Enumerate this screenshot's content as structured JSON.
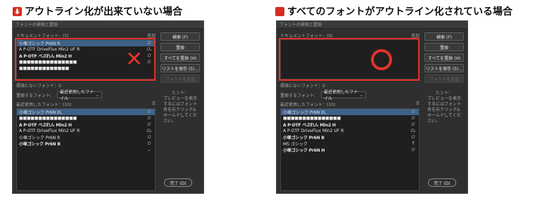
{
  "captions": {
    "left": "アウトライン化が出来ていない場合",
    "right": "すべてのフォントがアウトライン化されている場合"
  },
  "colors": {
    "accent_red": "#e4312b",
    "selection": "#3f6188"
  },
  "left_dialog": {
    "title": "フォントの検索と置換",
    "doc_header": "ドキュメントフォント：(5)",
    "doc_header_right": "追加",
    "doc_fonts": [
      {
        "name": "小塚ゴシック Pr6N R",
        "icon": "𝑂",
        "selected": true,
        "bold": false
      },
      {
        "name": "A P-OTF DriveFlux Min2 UF R",
        "icon": "𝑂ₐ",
        "selected": false,
        "bold": false
      },
      {
        "name": "A P-OTF ぺぷれん Min2 H",
        "icon": "𝑂",
        "selected": false,
        "bold": true
      },
      {
        "name": "■■■■■■■■■■■■■■■",
        "icon": "𝑂",
        "selected": false,
        "bold": true
      },
      {
        "name": "■■■■■■■■■■■■■",
        "icon": "",
        "selected": false,
        "bold": true
      }
    ],
    "no_fonts": "環境にないフォント：0",
    "replace_label": "置換するフォント：",
    "replace_value": "最近使用したファイル",
    "recent_header": "最近使用したフォント：(10)",
    "recent_fonts": [
      {
        "name": "小塚ゴシック Pr6N EL",
        "icon": "𝑂",
        "selected": true,
        "bold": false
      },
      {
        "name": "■■■■■■■■■■■■■■■",
        "icon": "𝑂",
        "selected": false,
        "bold": true
      },
      {
        "name": "A P-OTF ぺぷれん Min2 H",
        "icon": "𝑂",
        "selected": false,
        "bold": true
      },
      {
        "name": "A P-OTF DriveFlux Min2 UF R",
        "icon": "𝑂ₐ",
        "selected": false,
        "bold": false
      },
      {
        "name": "小塚ゴシック Pr6N R",
        "icon": "𝑂",
        "selected": false,
        "bold": false
      },
      {
        "name": "小塚ゴシック Pr6N B",
        "icon": "𝑂",
        "selected": false,
        "bold": true
      },
      {
        "name": "",
        "icon": "⌄",
        "selected": false,
        "bold": false
      }
    ],
    "buttons": {
      "find": "検索 (F)",
      "replace": "置換",
      "replace_all": "すべてを置換 (H)",
      "save_list": "リストを保存 (S)...",
      "add_font": "フォントを追加"
    },
    "hint_title": "ヒント：",
    "hint_text": "プレビューを表示するにはフォント名を右クリック&ホールドしてください。",
    "done": "完了 (D)",
    "mark": "✕"
  },
  "right_dialog": {
    "title": "フォントの検索と置換",
    "doc_header": "ドキュメントフォント：(0)",
    "doc_header_right": "追加",
    "no_fonts": "環境にないフォント：0",
    "replace_label": "置換するフォント：",
    "replace_value": "最近使用したファイル",
    "recent_header": "最近使用したフォント：(10)",
    "recent_fonts": [
      {
        "name": "小塚ゴシック Pr6N EL",
        "icon": "𝑂",
        "selected": true,
        "bold": false
      },
      {
        "name": "■■■■■■■■■■■■■■■",
        "icon": "𝑂",
        "selected": false,
        "bold": true
      },
      {
        "name": "A P-OTF ぺぷれん Min2 H",
        "icon": "𝑂",
        "selected": false,
        "bold": true
      },
      {
        "name": "A P-OTF DriveFlux Min2 UF R",
        "icon": "𝑂ₐ",
        "selected": false,
        "bold": false
      },
      {
        "name": "小塚ゴシック Pr6N B",
        "icon": "𝑂",
        "selected": false,
        "bold": true
      },
      {
        "name": "MS ゴシック",
        "icon": "Ŧ",
        "selected": false,
        "bold": false
      },
      {
        "name": "小塚ゴシック Pr6N H",
        "icon": "𝑂",
        "selected": false,
        "bold": true
      }
    ],
    "buttons": {
      "find": "検索 (F)",
      "replace": "置換",
      "replace_all": "すべてを置換 (H)",
      "save_list": "リストを保存 (S)...",
      "add_font": "フォントを追加"
    },
    "hint_title": "ヒント：",
    "hint_text": "プレビューを表示するにはフォント名を右クリック&ホールドしてください。",
    "done": "完了 (D)"
  }
}
